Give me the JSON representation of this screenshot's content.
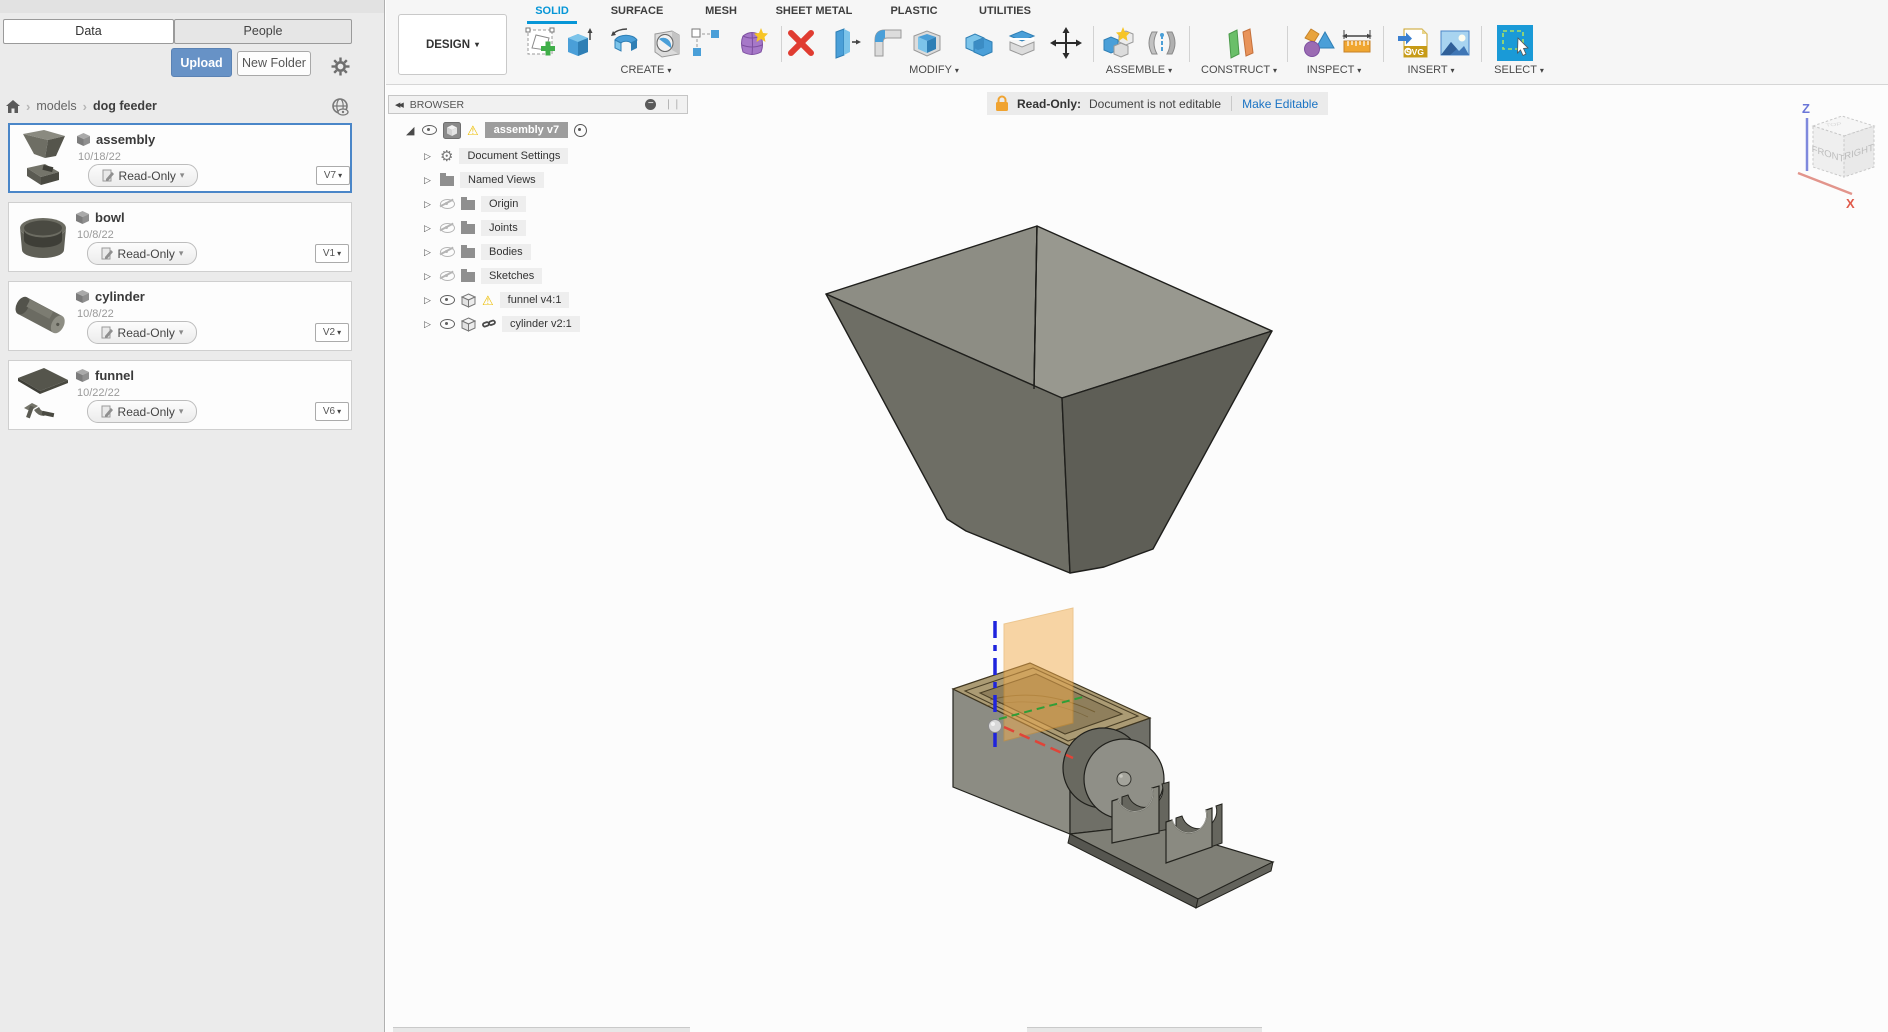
{
  "icons": {
    "caret": "▾",
    "chevron": "›",
    "collapse": "◀◀",
    "arrow_closed": "▷",
    "arrow_open": "◢",
    "warning": "⚠",
    "gear": "⚙",
    "grip": "❘❘"
  },
  "colors": {
    "accent_blue": "#0696d7",
    "upload_blue": "#6792c6",
    "selected_border": "#4a86c8",
    "readonly_lock_orange": "#f0a330",
    "link_blue": "#1a73c4",
    "construction_plane_orange": "#f3ad4e"
  },
  "sidebar": {
    "tabs": [
      {
        "label": "Data"
      },
      {
        "label": "People"
      }
    ],
    "upload_label": "Upload",
    "new_folder_label": "New Folder",
    "breadcrumb": {
      "items": [
        "models",
        "dog feeder"
      ]
    },
    "cards": [
      {
        "title": "assembly",
        "date": "10/18/22",
        "access": "Read-Only",
        "version": "V7"
      },
      {
        "title": "bowl",
        "date": "10/8/22",
        "access": "Read-Only",
        "version": "V1"
      },
      {
        "title": "cylinder",
        "date": "10/8/22",
        "access": "Read-Only",
        "version": "V2"
      },
      {
        "title": "funnel",
        "date": "10/22/22",
        "access": "Read-Only",
        "version": "V6"
      }
    ]
  },
  "toolbar": {
    "design_label": "DESIGN",
    "tabs": [
      {
        "label": "SOLID"
      },
      {
        "label": "SURFACE"
      },
      {
        "label": "MESH"
      },
      {
        "label": "SHEET METAL"
      },
      {
        "label": "PLASTIC"
      },
      {
        "label": "UTILITIES"
      }
    ],
    "groups": [
      {
        "label": "CREATE"
      },
      {
        "label": "MODIFY"
      },
      {
        "label": "ASSEMBLE"
      },
      {
        "label": "CONSTRUCT"
      },
      {
        "label": "INSPECT"
      },
      {
        "label": "INSERT"
      },
      {
        "label": "SELECT"
      }
    ],
    "insert_svg_badge": "SVG"
  },
  "readonly_bar": {
    "title": "Read-Only:",
    "message": "Document is not editable",
    "action": "Make Editable"
  },
  "browser": {
    "header": "BROWSER",
    "root_label": "assembly v7",
    "items": [
      {
        "label": "Document Settings"
      },
      {
        "label": "Named Views"
      },
      {
        "label": "Origin"
      },
      {
        "label": "Joints"
      },
      {
        "label": "Bodies"
      },
      {
        "label": "Sketches"
      },
      {
        "label": "funnel v4:1"
      },
      {
        "label": "cylinder v2:1"
      }
    ]
  },
  "viewcube": {
    "front": "FRONT",
    "right": "RIGHT",
    "top": "TOP",
    "z": "Z",
    "x": "X"
  }
}
